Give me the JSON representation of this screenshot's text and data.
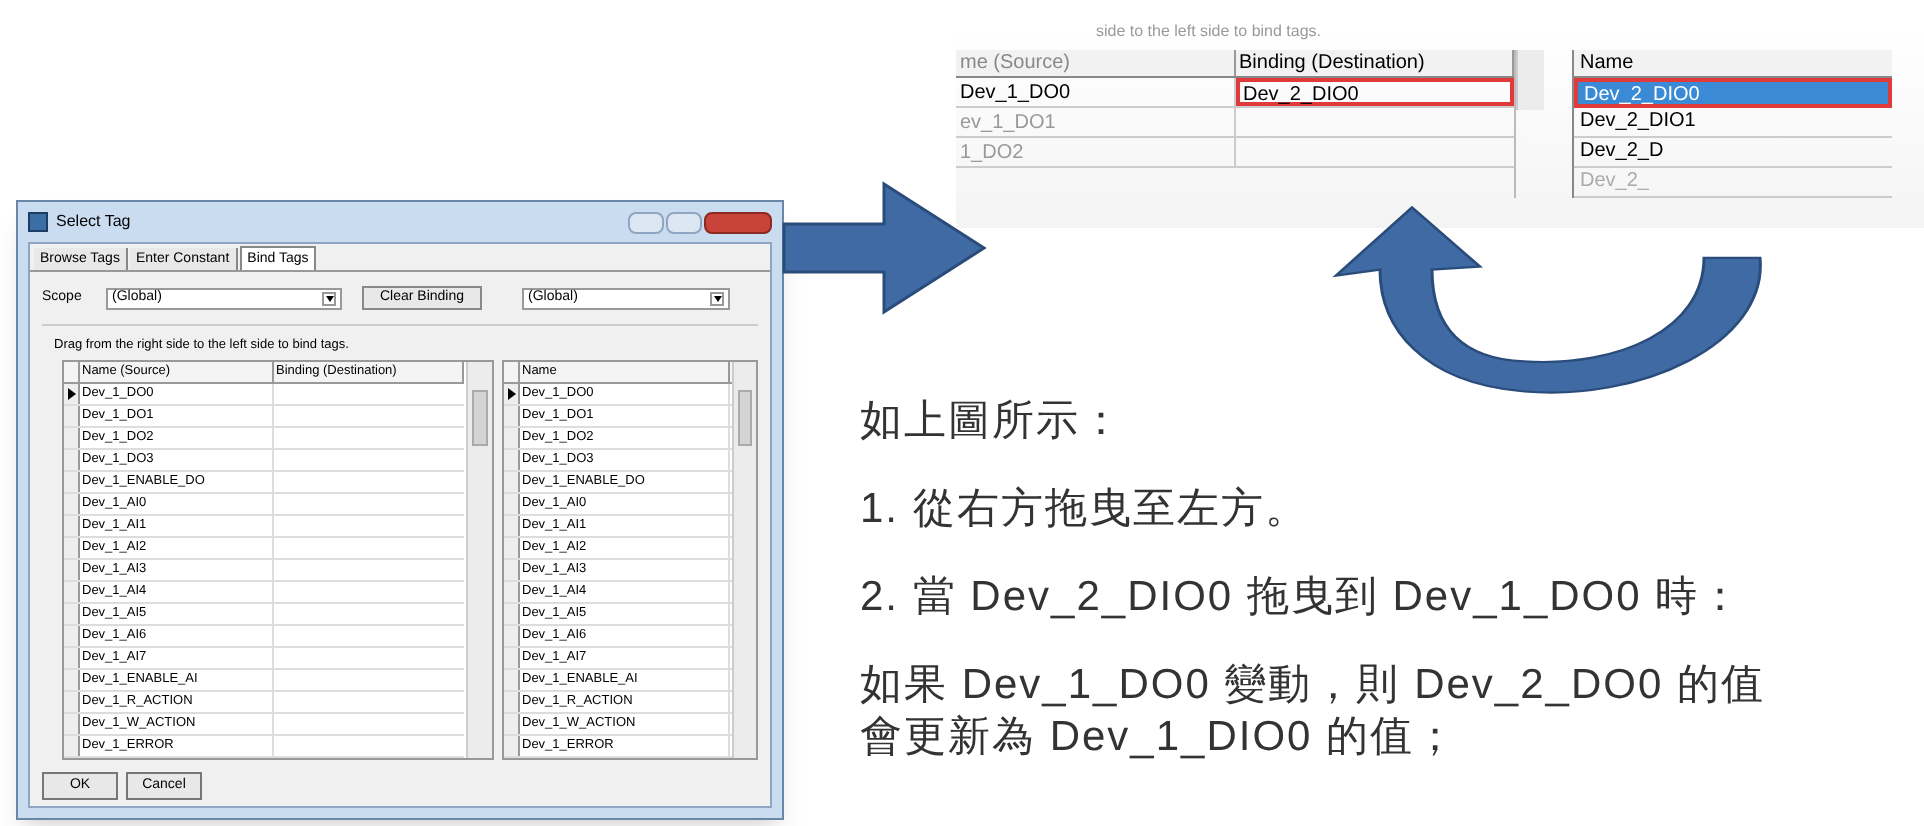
{
  "dialog": {
    "title": "Select Tag",
    "tabs": [
      {
        "label": "Browse Tags",
        "selected": false
      },
      {
        "label": "Enter Constant",
        "selected": false
      },
      {
        "label": "Bind Tags",
        "selected": true
      }
    ],
    "scope_label": "Scope",
    "scope_value": "(Global)",
    "clear_button": "Clear Binding",
    "right_scope_value": "(Global)",
    "instruction": "Drag from the right side to the left side to bind tags.",
    "source_table": {
      "columns": [
        "Name (Source)",
        "Binding (Destination)"
      ],
      "rows": [
        {
          "name": "Dev_1_DO0",
          "current": true
        },
        {
          "name": "Dev_1_DO1",
          "current": false
        },
        {
          "name": "Dev_1_DO2",
          "current": false
        },
        {
          "name": "Dev_1_DO3",
          "current": false
        },
        {
          "name": "Dev_1_ENABLE_DO",
          "current": false
        },
        {
          "name": "Dev_1_AI0",
          "current": false
        },
        {
          "name": "Dev_1_AI1",
          "current": false
        },
        {
          "name": "Dev_1_AI2",
          "current": false
        },
        {
          "name": "Dev_1_AI3",
          "current": false
        },
        {
          "name": "Dev_1_AI4",
          "current": false
        },
        {
          "name": "Dev_1_AI5",
          "current": false
        },
        {
          "name": "Dev_1_AI6",
          "current": false
        },
        {
          "name": "Dev_1_AI7",
          "current": false
        },
        {
          "name": "Dev_1_ENABLE_AI",
          "current": false
        },
        {
          "name": "Dev_1_R_ACTION",
          "current": false
        },
        {
          "name": "Dev_1_W_ACTION",
          "current": false
        },
        {
          "name": "Dev_1_ERROR",
          "current": false
        }
      ]
    },
    "tag_table": {
      "columns": [
        "Name"
      ],
      "rows": [
        {
          "name": "Dev_1_DO0",
          "current": true
        },
        {
          "name": "Dev_1_DO1",
          "current": false
        },
        {
          "name": "Dev_1_DO2",
          "current": false
        },
        {
          "name": "Dev_1_DO3",
          "current": false
        },
        {
          "name": "Dev_1_ENABLE_DO",
          "current": false
        },
        {
          "name": "Dev_1_AI0",
          "current": false
        },
        {
          "name": "Dev_1_AI1",
          "current": false
        },
        {
          "name": "Dev_1_AI2",
          "current": false
        },
        {
          "name": "Dev_1_AI3",
          "current": false
        },
        {
          "name": "Dev_1_AI4",
          "current": false
        },
        {
          "name": "Dev_1_AI5",
          "current": false
        },
        {
          "name": "Dev_1_AI6",
          "current": false
        },
        {
          "name": "Dev_1_AI7",
          "current": false
        },
        {
          "name": "Dev_1_ENABLE_AI",
          "current": false
        },
        {
          "name": "Dev_1_R_ACTION",
          "current": false
        },
        {
          "name": "Dev_1_W_ACTION",
          "current": false
        },
        {
          "name": "Dev_1_ERROR",
          "current": false
        }
      ]
    },
    "buttons": [
      "OK",
      "Cancel"
    ]
  },
  "zoom_inset": {
    "instruction": "side to the left side to bind tags.",
    "source_columns": [
      "me (Source)",
      "Binding (Destination)"
    ],
    "source_rows": [
      {
        "name": "Dev_1_DO0",
        "binding": "Dev_2_DIO0",
        "highlighted": true
      },
      {
        "name": "ev_1_DO1",
        "highlighted": false
      },
      {
        "name": "1_DO2",
        "highlighted": false
      }
    ],
    "tag_column": "Name",
    "tag_rows": [
      {
        "name": "Dev_2_DIO0",
        "selected": true
      },
      {
        "name": "Dev_2_DIO1",
        "selected": false
      },
      {
        "name": "Dev_2_D",
        "selected": false
      },
      {
        "name": "Dev_2_",
        "selected": false
      }
    ]
  },
  "notes": [
    "如上圖所示：",
    "1. 從右方拖曳至左方。",
    "2. 當 Dev_2_DIO0 拖曳到 Dev_1_DO0 時：",
    "如果 Dev_1_DO0 變動，則 Dev_2_DO0 的值會更新為 Dev_1_DIO0 的值；"
  ]
}
